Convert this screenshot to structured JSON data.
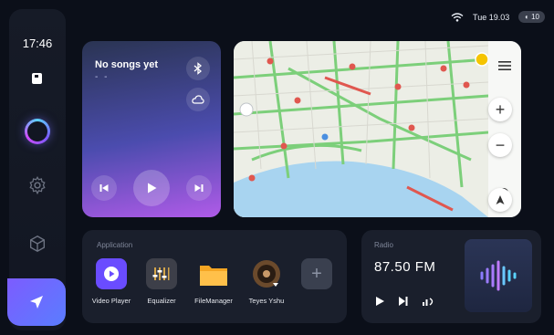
{
  "status": {
    "time_date": "Tue 19.03",
    "volume": "10"
  },
  "sidebar": {
    "clock": "17:46"
  },
  "music": {
    "title": "No songs yet",
    "subtitle": "- -"
  },
  "apps": {
    "section_label": "Application",
    "items": [
      {
        "label": "Video Player",
        "icon": "video-player-icon",
        "color": "#6a4cff"
      },
      {
        "label": "Equalizer",
        "icon": "equalizer-icon",
        "color": "#3d3f49"
      },
      {
        "label": "FileManager",
        "icon": "folder-icon",
        "color": "#f5a623"
      },
      {
        "label": "Teyes Yshu",
        "icon": "speaker-icon",
        "color": "#6b4a2c"
      }
    ],
    "add_label": "+"
  },
  "radio": {
    "section_label": "Radio",
    "frequency": "87.50 FM"
  },
  "colors": {
    "accent": "#7c5cff",
    "map_water": "#a8d4f0",
    "map_road": "#7ccf7a"
  }
}
